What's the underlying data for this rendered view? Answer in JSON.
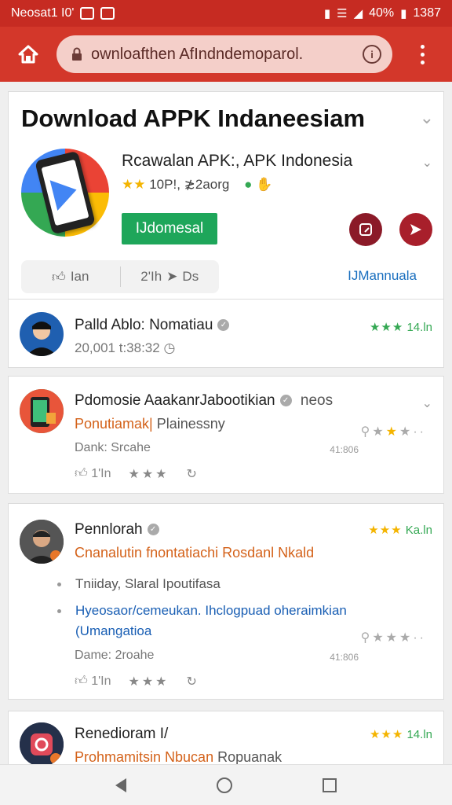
{
  "status_bar": {
    "left_text": "Neosat1 I0'",
    "right_text": "40%",
    "time": "1387"
  },
  "browser": {
    "url": "ownloafthen AfIndndemoparol.",
    "icons": [
      "home-icon",
      "lock-icon",
      "info-icon",
      "more-vert-icon"
    ]
  },
  "app": {
    "title": "Download APPK Indaneesiam",
    "subtitle": "Rcawalan APK:, APK Indonesia",
    "rating_text": "10P!, ≵2aorg",
    "download_label": "IJdomesal",
    "like_label": "Ian",
    "second_count": "2'Ih",
    "second_label": "Ds",
    "manual_link": "IJMannuala"
  },
  "reviews": [
    {
      "name": "Palld Ablo: Nomatiau",
      "rating": "14.ln",
      "meta": "20,001 t:38:32"
    },
    {
      "name": "Pdomosie AaakanrJabootikian",
      "name_suffix": "neos",
      "subtitle_orange": "Ponutiamak|",
      "subtitle_rest": "Plainessny",
      "date_label": "Dank: Srcahe",
      "small_num": "41:806",
      "like_count": "1'In"
    },
    {
      "name": "Pennlorah",
      "rating": "Ka.ln",
      "subtitle_orange": "Cnanalutin fnontatiachi Rosdanl Nkald",
      "bullets": [
        {
          "text": "Tniiday, Slaral Ipoutifasa",
          "style": "gray"
        },
        {
          "text": "Hyeosaor/cemeukan. Ihclogpuad oheraimkian",
          "style": "blue"
        },
        {
          "text": "(Umangatioa",
          "style": "blue"
        }
      ],
      "date_label": "Dame: 2roahe",
      "small_num": "41:806",
      "like_count": "1'In"
    },
    {
      "name": "Renedioram I/",
      "rating": "14.ln",
      "subtitle_orange": "Prohmamitsin Nbucan",
      "subtitle_rest": "Ropuanak"
    }
  ],
  "colors": {
    "brand_red": "#d3372a",
    "status_red": "#c62b22",
    "download_green": "#1ea65a",
    "rating_green": "#34a853",
    "star_gold": "#f4b400",
    "link_blue": "#1a6fbf"
  }
}
